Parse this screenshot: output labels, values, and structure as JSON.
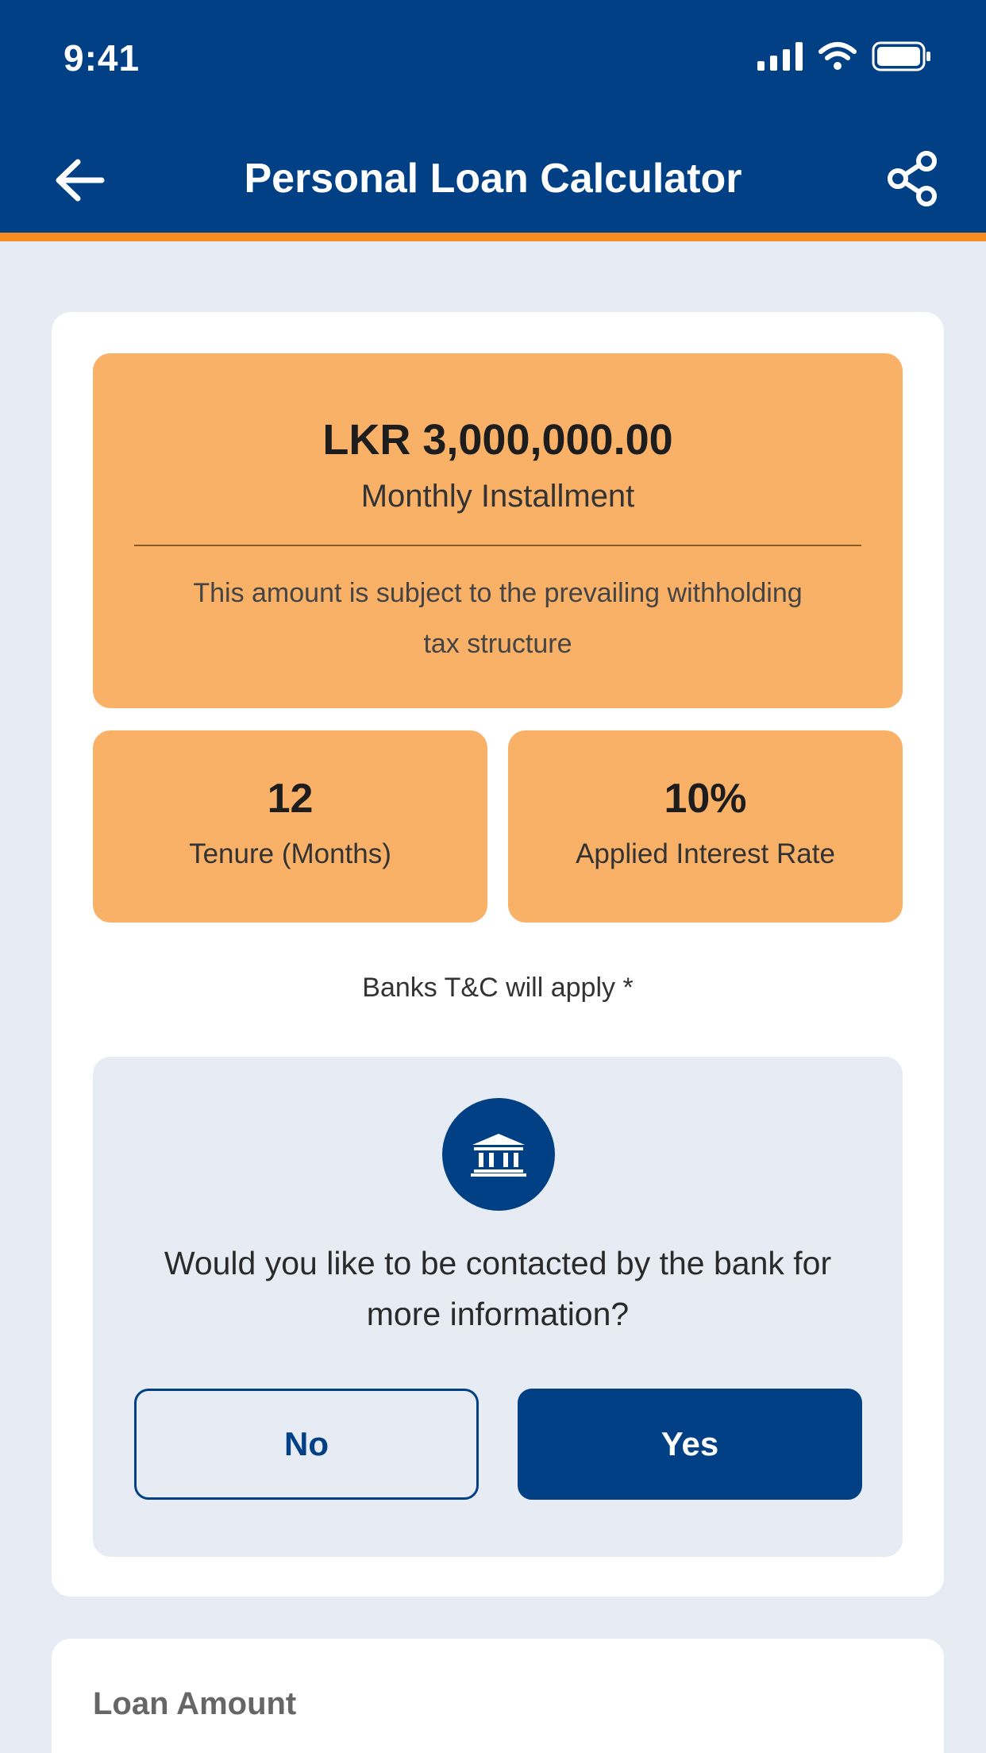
{
  "status_bar": {
    "time": "9:41"
  },
  "header": {
    "title": "Personal Loan Calculator",
    "back_icon": "arrow-left-icon",
    "share_icon": "share-icon"
  },
  "result": {
    "installment_amount": "LKR 3,000,000.00",
    "installment_label": "Monthly Installment",
    "installment_note": "This amount is subject to the prevailing withholding tax structure",
    "tenure_value": "12",
    "tenure_label": "Tenure (Months)",
    "rate_value": "10%",
    "rate_label": "Applied Interest Rate",
    "tc_note": "Banks T&C will apply *"
  },
  "contact": {
    "icon": "bank-icon",
    "question": "Would you like to be contacted by the bank for more information?",
    "no_label": "No",
    "yes_label": "Yes"
  },
  "loan_form": {
    "loan_amount_label": "Loan Amount"
  },
  "colors": {
    "primary": "#024085",
    "accent": "#f68b1f",
    "highlight": "#f9b168",
    "background": "#e7ecf4"
  }
}
